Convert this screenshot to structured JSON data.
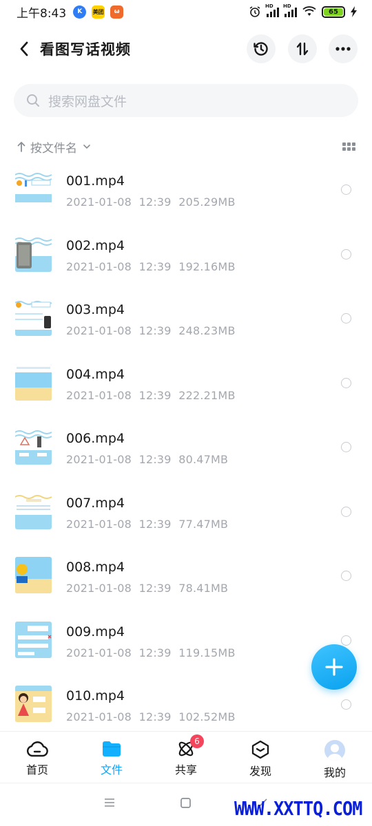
{
  "status_bar": {
    "time": "上午8:43",
    "battery": "65",
    "app_icons": [
      "K",
      "美团",
      "ω"
    ]
  },
  "header": {
    "title": "看图写话视频",
    "buttons": [
      "history-icon",
      "transfer-icon",
      "more-icon"
    ]
  },
  "search": {
    "placeholder": "搜索网盘文件"
  },
  "sort": {
    "label": "按文件名"
  },
  "files": [
    {
      "name": "001.mp4",
      "date": "2021-01-08",
      "time": "12:39",
      "size": "205.29MB"
    },
    {
      "name": "002.mp4",
      "date": "2021-01-08",
      "time": "12:39",
      "size": "192.16MB"
    },
    {
      "name": "003.mp4",
      "date": "2021-01-08",
      "time": "12:39",
      "size": "248.23MB"
    },
    {
      "name": "004.mp4",
      "date": "2021-01-08",
      "time": "12:39",
      "size": "222.21MB"
    },
    {
      "name": "006.mp4",
      "date": "2021-01-08",
      "time": "12:39",
      "size": "80.47MB"
    },
    {
      "name": "007.mp4",
      "date": "2021-01-08",
      "time": "12:39",
      "size": "77.47MB"
    },
    {
      "name": "008.mp4",
      "date": "2021-01-08",
      "time": "12:39",
      "size": "78.41MB"
    },
    {
      "name": "009.mp4",
      "date": "2021-01-08",
      "time": "12:39",
      "size": "119.15MB"
    },
    {
      "name": "010.mp4",
      "date": "2021-01-08",
      "time": "12:39",
      "size": "102.52MB"
    }
  ],
  "bottom_nav": [
    {
      "label": "首页"
    },
    {
      "label": "文件"
    },
    {
      "label": "共享",
      "badge": "6"
    },
    {
      "label": "发现"
    },
    {
      "label": "我的"
    }
  ],
  "watermark": "WWW.XXTTQ.COM",
  "colors": {
    "accent": "#06a7ff",
    "badge": "#f5455d",
    "muted": "#a4a8ae"
  }
}
